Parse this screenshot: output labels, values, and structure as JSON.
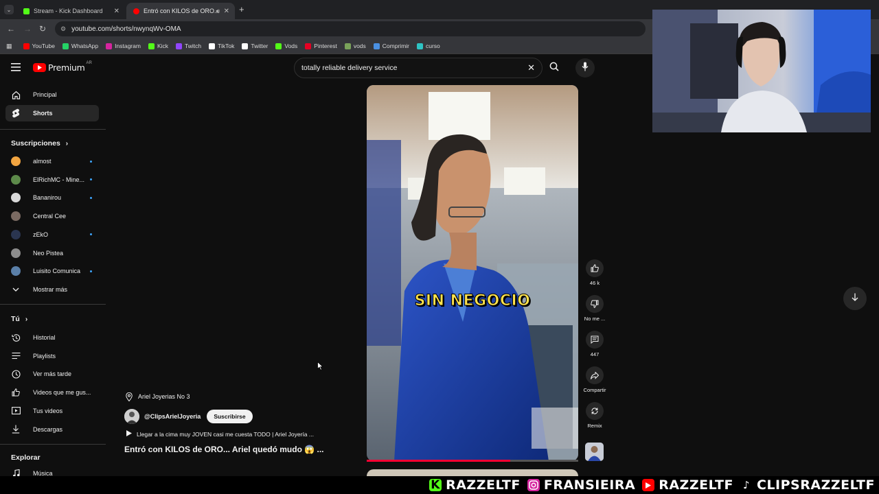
{
  "browser": {
    "tabs": [
      {
        "title": "Stream - Kick Dashboard",
        "favicon_color": "#53fc18"
      },
      {
        "title": "Entró con KILOS de ORO...",
        "favicon_color": "#ff0000"
      }
    ],
    "url": "youtube.com/shorts/nwynqWv-OMA",
    "bookmarks": [
      {
        "label": "YouTube",
        "color": "#ff0000"
      },
      {
        "label": "WhatsApp",
        "color": "#25d366"
      },
      {
        "label": "Instagram",
        "color": "#d6249f"
      },
      {
        "label": "Kick",
        "color": "#53fc18"
      },
      {
        "label": "Twitch",
        "color": "#9146ff"
      },
      {
        "label": "TikTok",
        "color": "#ffffff"
      },
      {
        "label": "Twitter",
        "color": "#ffffff"
      },
      {
        "label": "Vods",
        "color": "#53fc18"
      },
      {
        "label": "Pinterest",
        "color": "#e60023"
      },
      {
        "label": "vods",
        "color": "#7aa35a"
      },
      {
        "label": "Comprimir",
        "color": "#4a90e2"
      },
      {
        "label": "curso",
        "color": "#2ec4c4"
      }
    ]
  },
  "youtube": {
    "logo_text": "Premium",
    "country": "AR",
    "search_value": "totally reliable delivery service",
    "sidebar": {
      "main": [
        {
          "label": "Principal",
          "icon": "home-icon"
        },
        {
          "label": "Shorts",
          "icon": "shorts-icon"
        }
      ],
      "subs_title": "Suscripciones",
      "subs": [
        {
          "label": "almost",
          "color": "#f2a541",
          "dot": true
        },
        {
          "label": "ElRichMC - Mine...",
          "color": "#5d8a4a",
          "dot": true
        },
        {
          "label": "Bananirou",
          "color": "#d9d9d9",
          "dot": true
        },
        {
          "label": "Central Cee",
          "color": "#7a6a62",
          "dot": false
        },
        {
          "label": "zEkO",
          "color": "#2a3550",
          "dot": true
        },
        {
          "label": "Neo Pistea",
          "color": "#8c8c8c",
          "dot": false
        },
        {
          "label": "Luisito Comunica",
          "color": "#5a7fa8",
          "dot": true
        }
      ],
      "show_more": "Mostrar más",
      "you_title": "Tú",
      "you": [
        {
          "label": "Historial",
          "icon": "history-icon"
        },
        {
          "label": "Playlists",
          "icon": "playlists-icon"
        },
        {
          "label": "Ver más tarde",
          "icon": "watch-later-icon"
        },
        {
          "label": "Videos que me gus...",
          "icon": "like-icon"
        },
        {
          "label": "Tus videos",
          "icon": "your-videos-icon"
        },
        {
          "label": "Descargas",
          "icon": "downloads-icon"
        }
      ],
      "explore_title": "Explorar",
      "explore": [
        {
          "label": "Música",
          "icon": "music-icon"
        }
      ]
    },
    "short": {
      "caption": "SIN NEGOCIO",
      "location": "Ariel Joyerias No 3",
      "channel": "@ClipsArielJoyeria",
      "subscribe": "Suscribirse",
      "related": "Llegar a la cima muy JOVEN casi me cuesta TODO | Ariel Joyería ...",
      "title": "Entró con KILOS de ORO... Ariel quedó mudo 😱 ...",
      "progress": 0.68,
      "actions": {
        "likes": "46 k",
        "dislike": "No me ...",
        "comments": "447",
        "share": "Compartir",
        "remix": "Remix"
      }
    }
  },
  "stream_banner": [
    {
      "platform": "kick",
      "handle": "RAZZELTF",
      "color": "#53fc18"
    },
    {
      "platform": "instagram",
      "handle": "FRANSIEIRA",
      "color": "#d6249f"
    },
    {
      "platform": "youtube",
      "handle": "RAZZELTF",
      "color": "#ff0000"
    },
    {
      "platform": "tiktok",
      "handle": "CLIPSRAZZELTF",
      "color": "#ffffff"
    }
  ]
}
